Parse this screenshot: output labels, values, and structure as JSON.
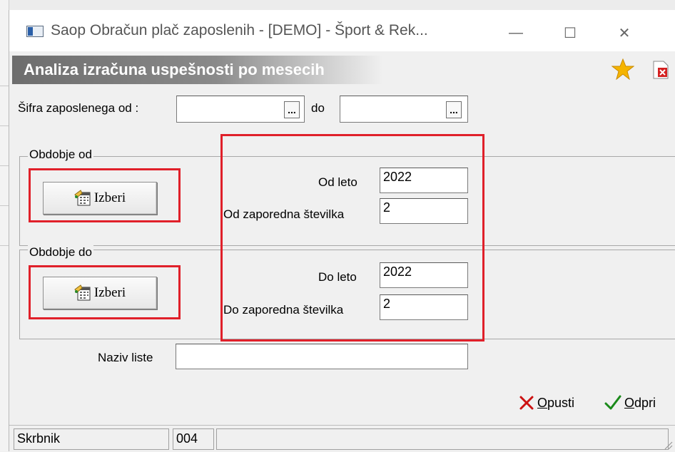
{
  "window": {
    "title": "Saop Obračun plač zaposlenih -  [DEMO] - Šport & Rek...",
    "minimize_glyph": "—",
    "maximize_glyph": "☐",
    "close_glyph": "✕"
  },
  "form": {
    "title": "Analiza izračuna uspešnosti po mesecih",
    "employee_code_from_label": "Šifra zaposlenega od :",
    "employee_code_from_value": "",
    "employee_code_to_label": "do",
    "employee_code_to_value": "",
    "ellipsis": "..."
  },
  "period_from": {
    "group_label": "Obdobje od",
    "choose_button": "Izberi",
    "year_label": "Od leto",
    "year_value": "2022",
    "seq_label": "Od zaporedna številka",
    "seq_value": "2"
  },
  "period_to": {
    "group_label": "Obdobje do",
    "choose_button": "Izberi",
    "year_label": "Do leto",
    "year_value": "2022",
    "seq_label": "Do zaporedna številka",
    "seq_value": "2"
  },
  "list_name": {
    "label": "Naziv liste",
    "value": ""
  },
  "actions": {
    "cancel": "Opusti",
    "open": "Odpri"
  },
  "status": {
    "user": "Skrbnik",
    "code": "004",
    "extra": ""
  },
  "colors": {
    "highlight_red": "#e0202a",
    "star": "#f5b400",
    "check_green": "#1a8a1a",
    "cancel_red": "#cc1111"
  }
}
